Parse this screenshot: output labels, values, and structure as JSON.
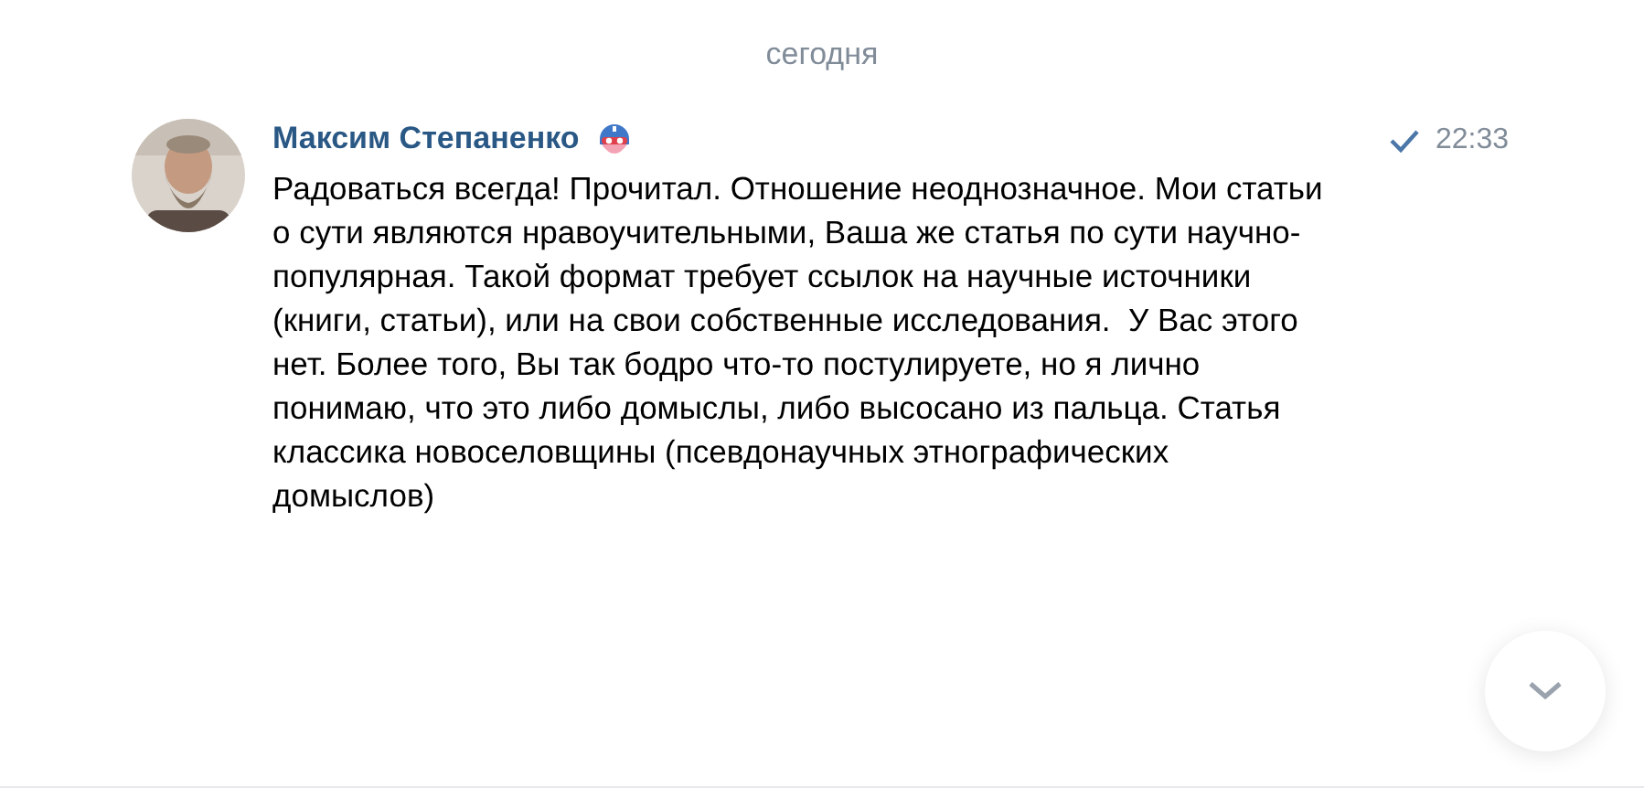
{
  "date_separator": "сегодня",
  "message": {
    "author": "Максим Степаненко",
    "read": true,
    "time": "22:33",
    "text": "Радоваться всегда! Прочитал. Отношение неоднозначное. Мои статьи о сути являются нравоучительными, Ваша же статья по сути научно-популярная. Такой формат требует ссылок на научные источники (книги, статьи), или на свои собственные исследования.  У Вас этого нет. Более того, Вы так бодро что-то постулируете, но я лично понимаю, что это либо домыслы, либо высосано из пальца. Статья классика новоселовщины (псевдонаучных этнографических домыслов)"
  }
}
